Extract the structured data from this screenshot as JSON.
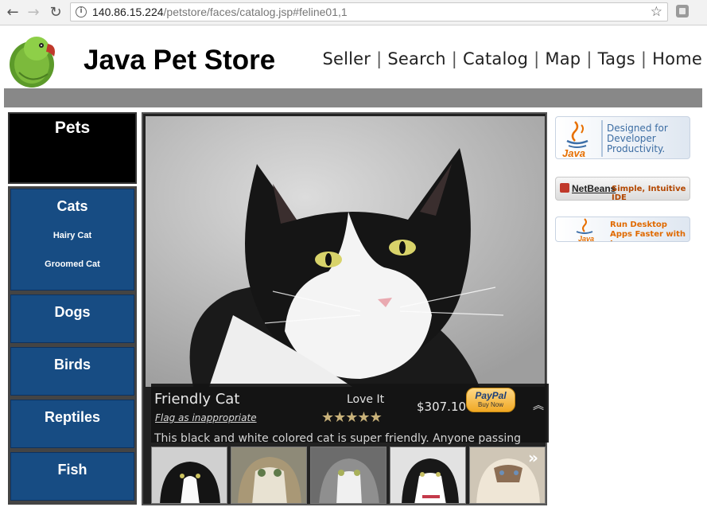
{
  "browser": {
    "url_host": "140.86.15.224",
    "url_path": "/petstore/faces/catalog.jsp#feline01,1"
  },
  "header": {
    "title": "Java Pet Store",
    "nav": [
      "Seller",
      "Search",
      "Catalog",
      "Map",
      "Tags",
      "Home"
    ]
  },
  "sidebar": {
    "heading": "Pets",
    "categories": [
      {
        "name": "Cats",
        "subs": [
          "Hairy Cat",
          "Groomed Cat"
        ]
      },
      {
        "name": "Dogs",
        "subs": []
      },
      {
        "name": "Birds",
        "subs": []
      },
      {
        "name": "Reptiles",
        "subs": []
      },
      {
        "name": "Fish",
        "subs": []
      }
    ]
  },
  "item": {
    "name": "Friendly Cat",
    "flag_link": "Flag as inappropriate",
    "love_label": "Love It",
    "rating_stars": 5,
    "price": "$307.10",
    "paypal_label": "PayPal",
    "paypal_sub": "Buy Now",
    "description": "This black and white colored cat is super friendly. Anyone passing"
  },
  "ads": {
    "java_text": "Designed for Developer Productivity.",
    "java_brand": "Java",
    "netbeans_brand": "NetBeans",
    "netbeans_text": "Simple, Intuitive IDE",
    "desktop_text": "Run Desktop Apps Faster with Java"
  },
  "colors": {
    "category_blue": "#174c83",
    "header_bar_gray": "#888888",
    "java_orange": "#e76f00"
  }
}
